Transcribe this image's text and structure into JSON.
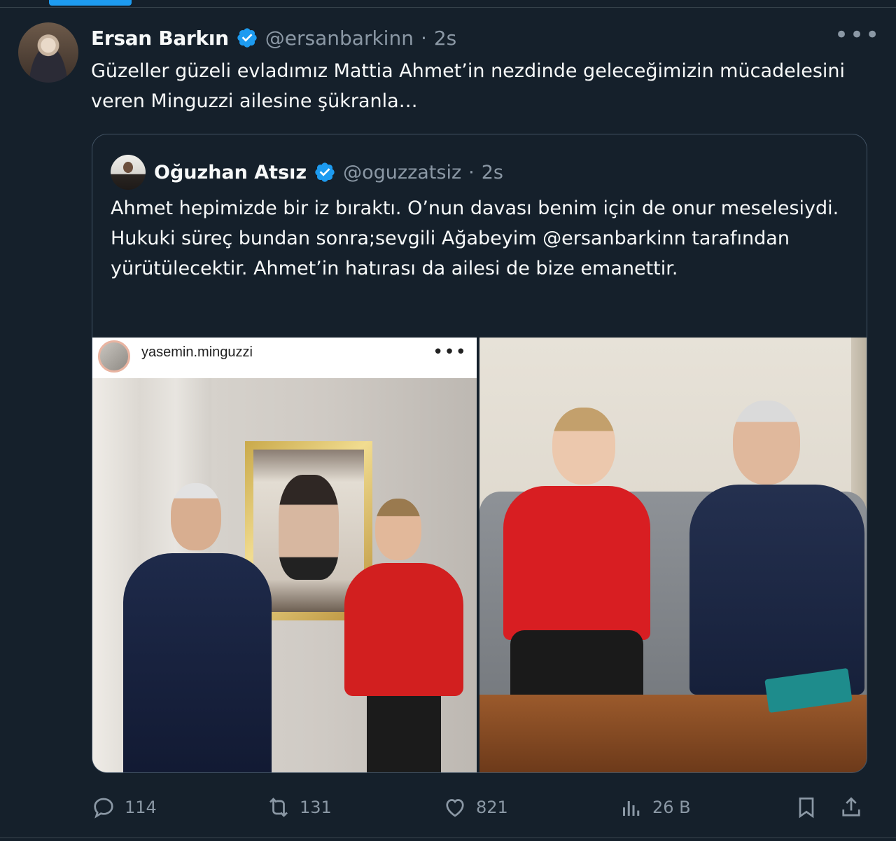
{
  "tweet": {
    "author": {
      "display_name": "Ersan Barkın",
      "handle": "@ersanbarkinn",
      "separator": "·",
      "time": "2s"
    },
    "text": "Güzeller güzeli evladımız Mattia Ahmet’in nezdinde geleceğimizin mücadelesini veren Minguzzi ailesine şükranla…",
    "more_icon": "more-horizontal-icon"
  },
  "quote": {
    "author": {
      "display_name": "Oğuzhan Atsız",
      "handle": "@oguzzatsiz",
      "separator": "·",
      "time": "2s"
    },
    "text": "Ahmet hepimizde bir iz bıraktı. O’nun davası benim için de onur meselesiydi. Hukuki süreç bundan sonra;sevgili Ağabeyim @ersanbarkinn tarafından yürütülecektir. Ahmet’in hatırası da ailesi de bize emanettir.",
    "media": {
      "left_photo": {
        "ig_username": "yasemin.minguzzi",
        "ig_more": "•••"
      }
    }
  },
  "actions": {
    "reply_count": "114",
    "retweet_count": "131",
    "like_count": "821",
    "views_count": "26 B"
  },
  "colors": {
    "background": "#15202b",
    "accent": "#1d9bf0",
    "muted": "#8b98a5",
    "border": "#425364"
  }
}
